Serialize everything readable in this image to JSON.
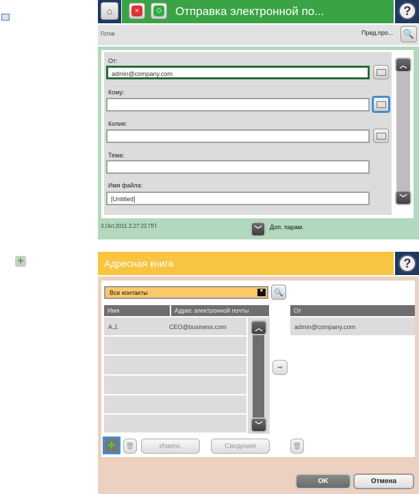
{
  "top": {
    "title": "Отправка электронной по...",
    "status": "Готов",
    "preview_label": "Пред.про...",
    "fields": [
      {
        "label": "От:",
        "value": "admin@company.com"
      },
      {
        "label": "Кому:",
        "value": ""
      },
      {
        "label": "Копия:",
        "value": ""
      },
      {
        "label": "Тема:",
        "value": ""
      },
      {
        "label": "Имя файла:",
        "value": "[Untitled]"
      }
    ],
    "datetime": "3.Окт.2011 2:27:22 ПП",
    "more_options": "Доп. парам."
  },
  "addressbook": {
    "title": "Адресная книга",
    "filter": "Все контакты",
    "columns": [
      "Имя",
      "Адрес электронной почты"
    ],
    "rows": [
      {
        "name": "A.J.",
        "email": "CEO@business.com"
      }
    ],
    "from_header": "От",
    "from_value": "admin@company.com",
    "edit_label": "Измен.",
    "details_label": "Сведения",
    "ok_label": "OK",
    "cancel_label": "Отмена"
  },
  "colors": {
    "green": "#3aa345",
    "navy": "#1d3a63",
    "yellow": "#f9c440",
    "pink": "#ecd0c0",
    "form_bg": "#b2d8be"
  }
}
